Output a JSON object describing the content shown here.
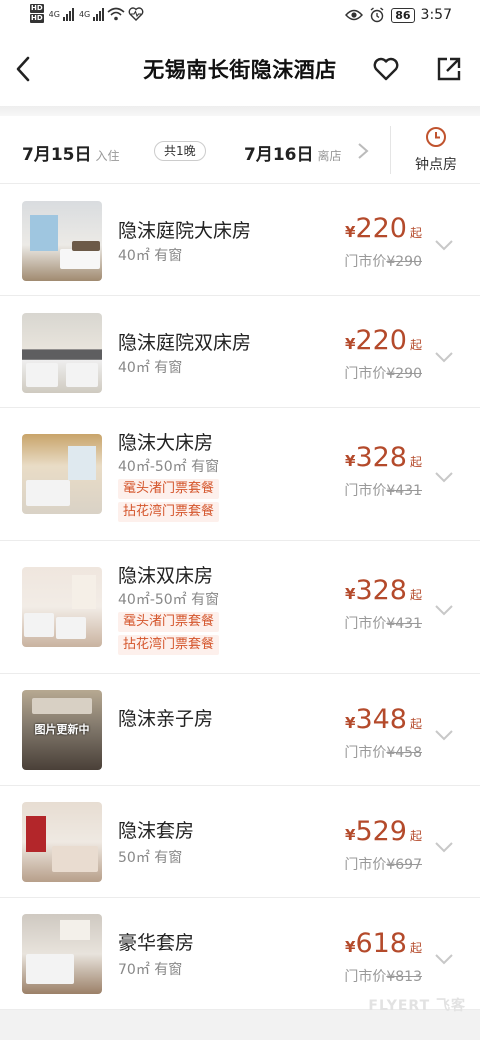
{
  "status_bar": {
    "time": "3:57",
    "battery": "86",
    "network_1": "4G",
    "network_2": "4G",
    "hd_1": "HD",
    "hd_2": "HD"
  },
  "header": {
    "title": "无锡南长街隐沫酒店",
    "back_icon": "chevron-left-icon",
    "favorite_icon": "heart-icon",
    "share_icon": "share-icon"
  },
  "date_bar": {
    "checkin_date": "7月15日",
    "checkin_label": "入住",
    "nights": "共1晚",
    "checkout_date": "7月16日",
    "checkout_label": "离店",
    "hourly_label": "钟点房"
  },
  "rooms": [
    {
      "name": "隐沫庭院大床房",
      "info": "40㎡ 有窗",
      "tags": [],
      "currency": "¥",
      "price": "220",
      "suffix": "起",
      "market_label": "门市价",
      "market_price": "¥290"
    },
    {
      "name": "隐沫庭院双床房",
      "info": "40㎡ 有窗",
      "tags": [],
      "currency": "¥",
      "price": "220",
      "suffix": "起",
      "market_label": "门市价",
      "market_price": "¥290"
    },
    {
      "name": "隐沫大床房",
      "info": "40㎡-50㎡ 有窗",
      "tags": [
        "鼋头渚门票套餐",
        "拈花湾门票套餐"
      ],
      "currency": "¥",
      "price": "328",
      "suffix": "起",
      "market_label": "门市价",
      "market_price": "¥431"
    },
    {
      "name": "隐沫双床房",
      "info": "40㎡-50㎡ 有窗",
      "tags": [
        "鼋头渚门票套餐",
        "拈花湾门票套餐"
      ],
      "currency": "¥",
      "price": "328",
      "suffix": "起",
      "market_label": "门市价",
      "market_price": "¥431"
    },
    {
      "name": "隐沫亲子房",
      "info": "",
      "tags": [],
      "image_note": "图片更新中",
      "currency": "¥",
      "price": "348",
      "suffix": "起",
      "market_label": "门市价",
      "market_price": "¥458"
    },
    {
      "name": "隐沫套房",
      "info": "50㎡ 有窗",
      "tags": [],
      "currency": "¥",
      "price": "529",
      "suffix": "起",
      "market_label": "门市价",
      "market_price": "¥697"
    },
    {
      "name": "豪华套房",
      "info": "70㎡ 有窗",
      "tags": [],
      "currency": "¥",
      "price": "618",
      "suffix": "起",
      "market_label": "门市价",
      "market_price": "¥813"
    }
  ],
  "watermark": "FLYERT 飞客",
  "colors": {
    "price": "#b44a2b",
    "tag_text": "#d4552b",
    "tag_bg": "#fdf0ec"
  }
}
